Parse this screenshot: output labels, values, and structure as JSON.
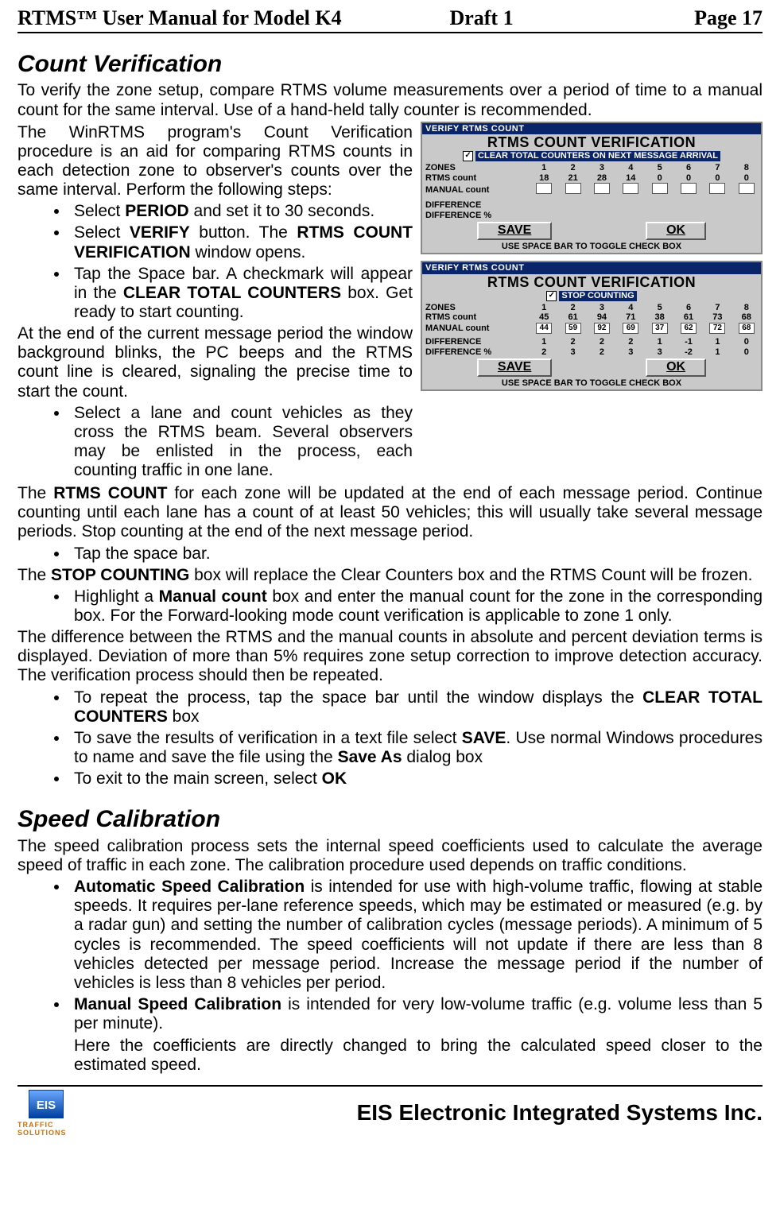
{
  "header": {
    "product": "RTMS™  User Manual for Model K4",
    "draft": "Draft 1",
    "page": "Page 17"
  },
  "section1": {
    "title": "Count Verification",
    "p1": "To verify the zone setup, compare RTMS volume measurements over a period of time to a manual count for the same interval. Use of a hand-held tally counter is recommended.",
    "p2": "The WinRTMS program's Count Verification procedure is an aid for comparing RTMS counts in each detection zone to observer's counts over the same interval. Perform the following steps:",
    "bulletsA": {
      "b1": {
        "pre": "Select ",
        "bold": "PERIOD",
        "post": " and set it to 30 seconds."
      },
      "b2": {
        "pre": "Select ",
        "bold1": "VERIFY",
        "mid": " button.   The ",
        "bold2": "RTMS COUNT VERIFICATION",
        "post": " window opens."
      },
      "b3": {
        "pre": "Tap the Space bar.  A checkmark will appear in the ",
        "bold": "CLEAR TOTAL COUNTERS",
        "post": " box.  Get ready to start counting."
      }
    },
    "p3": "At the end of the current message period the window background blinks, the PC beeps and the RTMS count line is cleared, signaling the precise time to start the count.",
    "b4": "Select a lane and count vehicles as they cross the RTMS beam. Several observers may be enlisted in the process, each counting traffic in one lane.",
    "p4": {
      "pre": "The ",
      "bold": "RTMS COUNT",
      "post": " for each zone will be updated at the end of each message period.  Continue counting until each lane has a count of at least 50 vehicles; this will usually take several message periods.  Stop counting at the end of the next message period."
    },
    "b5": "Tap the space bar.",
    "p5": {
      "pre": "The ",
      "bold": "STOP COUNTING",
      "post": " box will replace the Clear Counters box and the RTMS Count will be frozen."
    },
    "b6": {
      "pre": "Highlight a ",
      "bold": "Manual count",
      "post": " box and enter the manual count for the zone in the corresponding box. For the Forward-looking mode count verification is applicable to zone 1 only."
    },
    "p6": "The difference between the RTMS and the manual counts in absolute and percent deviation terms is displayed. Deviation of more than 5% requires zone setup correction to improve detection accuracy. The verification process should then be repeated.",
    "b7": {
      "pre": "To repeat the process, tap the space bar until the window displays the ",
      "bold": "CLEAR TOTAL COUNTERS",
      "post": " box"
    },
    "b8": {
      "pre": "To save the results of verification in a text file select ",
      "bold1": "SAVE",
      "mid": ".  Use normal Windows procedures to name and save the file using the ",
      "bold2": "Save As",
      "post": " dialog box"
    },
    "b9": {
      "pre": "To exit to the main screen,  select ",
      "bold": "OK"
    }
  },
  "section2": {
    "title": "Speed Calibration",
    "p1": "The speed calibration process sets the internal speed coefficients used to calculate the average speed of traffic in each zone.  The calibration procedure used depends on traffic conditions.",
    "b1": {
      "bold": "Automatic Speed Calibration",
      "post": " is intended for use with high-volume traffic, flowing at stable speeds. It requires per-lane reference speeds, which may be estimated or measured (e.g. by a radar gun) and setting the number of calibration cycles (message periods). A minimum of 5 cycles is recommended.  The speed coefficients will not update if there are less than 8 vehicles detected per message period.  Increase the message period if the number of vehicles is less than 8 vehicles per period."
    },
    "b2": {
      "bold": "Manual Speed Calibration",
      "post": " is intended for very low-volume traffic (e.g. volume less than 5 per minute)."
    },
    "b2_after": "Here the coefficients are directly changed to bring the calculated speed closer to the estimated speed."
  },
  "win1": {
    "titlebar": "VERIFY RTMS COUNT",
    "title": "RTMS COUNT VERIFICATION",
    "check_label": "CLEAR TOTAL COUNTERS ON NEXT MESSAGE ARRIVAL",
    "rows": {
      "zones": "ZONES",
      "rtms": "RTMS count",
      "manual": "MANUAL count",
      "diff": "DIFFERENCE",
      "diffp": "DIFFERENCE %"
    },
    "zone_headers": [
      "1",
      "2",
      "3",
      "4",
      "5",
      "6",
      "7",
      "8"
    ],
    "rtms_values": [
      "18",
      "21",
      "28",
      "14",
      "0",
      "0",
      "0",
      "0"
    ],
    "save": "SAVE",
    "ok": "OK",
    "hint": "USE SPACE BAR TO TOGGLE CHECK BOX"
  },
  "win2": {
    "titlebar": "VERIFY RTMS COUNT",
    "title": "RTMS COUNT VERIFICATION",
    "check_label": "STOP COUNTING",
    "rows": {
      "zones": "ZONES",
      "rtms": "RTMS count",
      "manual": "MANUAL count",
      "diff": "DIFFERENCE",
      "diffp": "DIFFERENCE %"
    },
    "zone_headers": [
      "1",
      "2",
      "3",
      "4",
      "5",
      "6",
      "7",
      "8"
    ],
    "rtms_values": [
      "45",
      "61",
      "94",
      "71",
      "38",
      "61",
      "73",
      "68"
    ],
    "manual_values": [
      "44",
      "59",
      "92",
      "69",
      "37",
      "62",
      "72",
      "68"
    ],
    "diff_values": [
      "1",
      "2",
      "2",
      "2",
      "1",
      "-1",
      "1",
      "0"
    ],
    "diffp_values": [
      "2",
      "3",
      "2",
      "3",
      "3",
      "-2",
      "1",
      "0"
    ],
    "save": "SAVE",
    "ok": "OK",
    "hint": "USE SPACE BAR TO TOGGLE CHECK BOX"
  },
  "footer": {
    "logo_tag": "TRAFFIC SOLUTIONS",
    "company": "EIS Electronic Integrated Systems Inc."
  }
}
